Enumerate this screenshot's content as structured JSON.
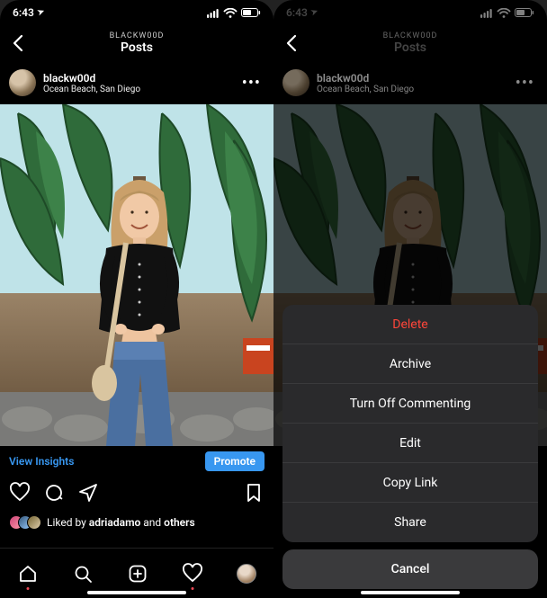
{
  "status": {
    "time": "6:43",
    "location_glyph": "➤"
  },
  "header": {
    "context": "BLACKW00D",
    "title": "Posts"
  },
  "post": {
    "username": "blackw00d",
    "location": "Ocean Beach, San Diego",
    "more_glyph": "•••"
  },
  "insights": {
    "view_label": "View Insights",
    "promote_label": "Promote"
  },
  "likes": {
    "prefix": "Liked by ",
    "user": "adriadamo",
    "middle": " and ",
    "suffix": "others"
  },
  "action_sheet": {
    "items": [
      {
        "label": "Delete",
        "destructive": true
      },
      {
        "label": "Archive",
        "destructive": false
      },
      {
        "label": "Turn Off Commenting",
        "destructive": false
      },
      {
        "label": "Edit",
        "destructive": false
      },
      {
        "label": "Copy Link",
        "destructive": false
      },
      {
        "label": "Share",
        "destructive": false
      }
    ],
    "cancel": "Cancel"
  },
  "colors": {
    "accent": "#3897f0",
    "destructive": "#ff453a"
  }
}
